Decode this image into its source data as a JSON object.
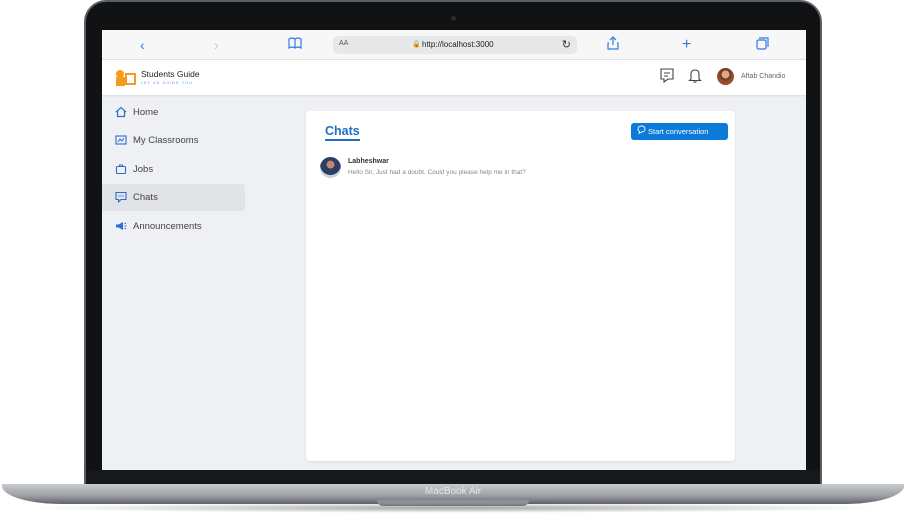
{
  "device": {
    "model_label": "MacBook Air"
  },
  "browser": {
    "reader_label": "AA",
    "url": "http://localhost:3000",
    "icons": [
      "back-icon",
      "forward-icon",
      "bookmarks-icon",
      "lock-icon",
      "reload-icon",
      "share-icon",
      "new-tab-icon",
      "tabs-icon"
    ]
  },
  "header": {
    "brand_name": "Students Guide",
    "brand_tagline": "LET US GUIDE YOU",
    "user_name": "Aftab Chandio",
    "icons": [
      "messages-icon",
      "bell-icon"
    ]
  },
  "sidebar": {
    "items": [
      {
        "label": "Home",
        "icon": "home-icon",
        "active": false
      },
      {
        "label": "My Classrooms",
        "icon": "classroom-icon",
        "active": false
      },
      {
        "label": "Jobs",
        "icon": "briefcase-icon",
        "active": false
      },
      {
        "label": "Chats",
        "icon": "chat-icon",
        "active": true
      },
      {
        "label": "Announcements",
        "icon": "megaphone-icon",
        "active": false
      }
    ]
  },
  "main": {
    "title": "Chats",
    "start_button_label": "Start conversation",
    "chats": [
      {
        "name": "Labheshwar",
        "message": "Hello Sir, Just had a doubt. Could you please help me in that?"
      }
    ]
  },
  "colors": {
    "accent": "#0b7ad8",
    "brand": "#f59a1c",
    "background": "#eef0f3"
  }
}
